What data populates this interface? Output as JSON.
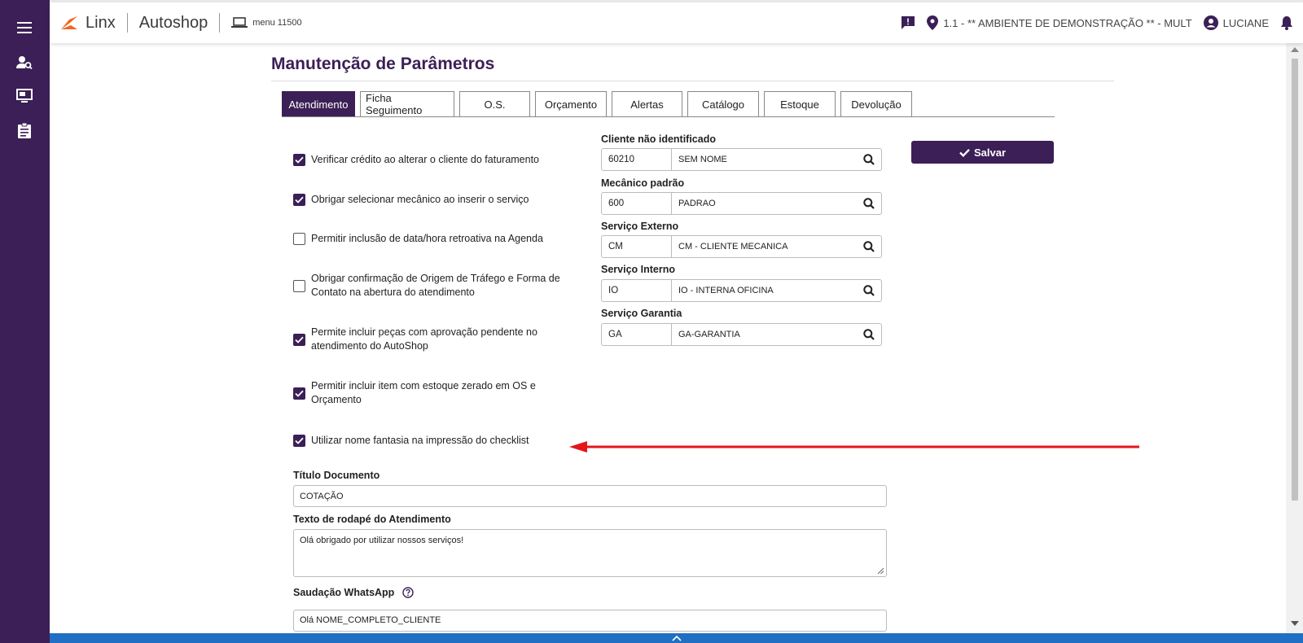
{
  "header": {
    "brand_linx": "Linx",
    "brand_app": "Autoshop",
    "menu_ref": "menu 11500",
    "environment": "1.1 - ** AMBIENTE DE DEMONSTRAÇÃO ** - MULT",
    "user": "LUCIANE"
  },
  "page": {
    "title": "Manutenção de Parâmetros"
  },
  "tabs": [
    {
      "label": "Atendimento",
      "active": true
    },
    {
      "label": "Ficha Seguimento"
    },
    {
      "label": "O.S."
    },
    {
      "label": "Orçamento"
    },
    {
      "label": "Alertas"
    },
    {
      "label": "Catálogo"
    },
    {
      "label": "Estoque"
    },
    {
      "label": "Devolução"
    }
  ],
  "checkboxes": [
    {
      "label": "Verificar crédito ao alterar o cliente do faturamento",
      "checked": true
    },
    {
      "label": "Obrigar selecionar mecânico ao inserir o serviço",
      "checked": true
    },
    {
      "label": "Permitir inclusão de data/hora retroativa na Agenda",
      "checked": false
    },
    {
      "label": "Obrigar confirmação de Origem de Tráfego e Forma de Contato na abertura do atendimento",
      "checked": false
    },
    {
      "label": "Permite incluir peças com aprovação pendente no atendimento do AutoShop",
      "checked": true
    },
    {
      "label": "Permitir incluir item com estoque zerado em OS e Orçamento",
      "checked": true
    },
    {
      "label": "Utilizar nome fantasia na impressão do checklist",
      "checked": true
    }
  ],
  "lookups": [
    {
      "label": "Cliente não identificado",
      "code": "60210",
      "desc": "SEM NOME"
    },
    {
      "label": "Mecânico padrão",
      "code": "600",
      "desc": "PADRAO"
    },
    {
      "label": "Serviço Externo",
      "code": "CM",
      "desc": "CM - CLIENTE MECANICA"
    },
    {
      "label": "Serviço Interno",
      "code": "IO",
      "desc": "IO - INTERNA OFICINA"
    },
    {
      "label": "Serviço Garantia",
      "code": "GA",
      "desc": "GA-GARANTIA"
    }
  ],
  "save_label": "Salvar",
  "titulo_documento": {
    "label": "Título Documento",
    "value": "COTAÇÃO"
  },
  "texto_rodape": {
    "label": "Texto de rodapé do Atendimento",
    "value": "Olá obrigado por utilizar nossos serviços!"
  },
  "saudacao": {
    "label": "Saudação WhatsApp",
    "value": "Olá NOME_COMPLETO_CLIENTE"
  },
  "colors": {
    "primary": "#3b1f56",
    "accent_orange": "#f26522",
    "annotation_red": "#e3161b",
    "footer_blue": "#1f6fc4"
  }
}
